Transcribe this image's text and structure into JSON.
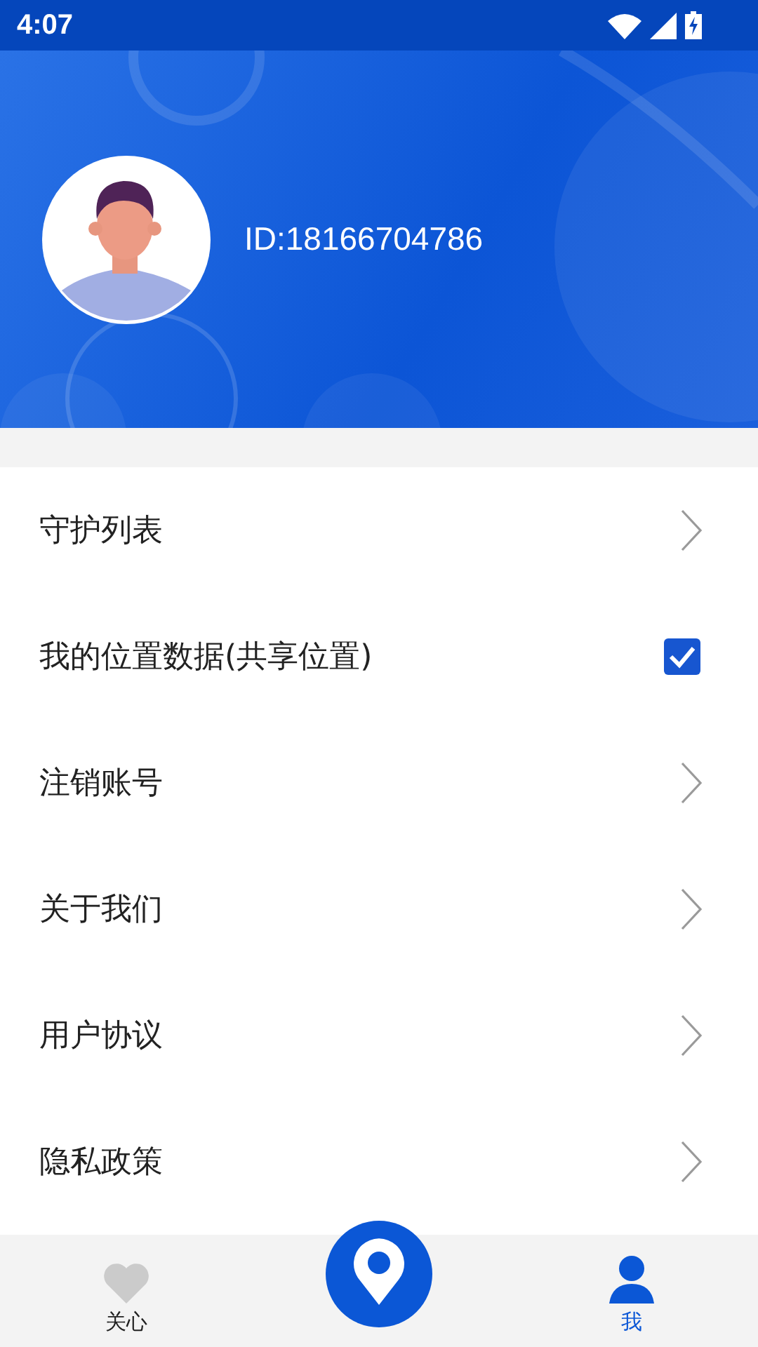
{
  "status_bar": {
    "time": "4:07"
  },
  "profile": {
    "id_text": "ID:18166704786"
  },
  "menu": [
    {
      "label": "守护列表",
      "kind": "link"
    },
    {
      "label": "我的位置数据(共享位置)",
      "kind": "checkbox",
      "checked": true
    },
    {
      "label": "注销账号",
      "kind": "link"
    },
    {
      "label": "关于我们",
      "kind": "link"
    },
    {
      "label": "用户协议",
      "kind": "link"
    },
    {
      "label": "隐私政策",
      "kind": "link"
    }
  ],
  "bottom_nav": [
    {
      "label": "关心",
      "kind": "heart",
      "selected": false
    },
    {
      "kind": "center"
    },
    {
      "label": "我",
      "kind": "person",
      "selected": true
    }
  ]
}
